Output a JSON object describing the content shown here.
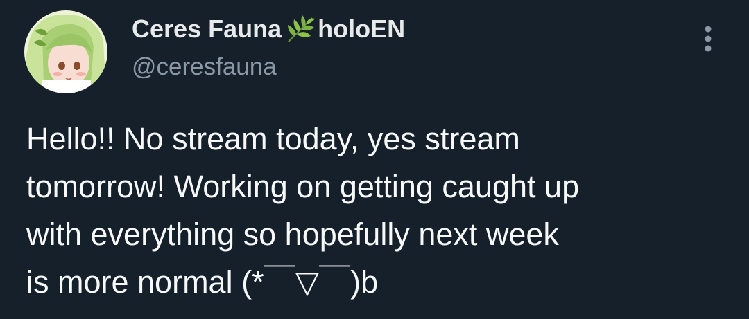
{
  "tweet": {
    "author": {
      "display_name": "Ceres Fauna",
      "name_emoji": "leaf-icon",
      "name_suffix": "holoEN",
      "handle": "@ceresfauna",
      "avatar": "avatar-image"
    },
    "menu_icon": "more-vertical-icon",
    "body_lines": [
      "Hello!! No stream today, yes stream",
      "tomorrow! Working on getting caught up",
      "with everything so hopefully next week",
      "is more normal (*￣▽￣)b"
    ]
  },
  "colors": {
    "background": "#15202b",
    "text_primary": "#f7f9f9",
    "text_secondary": "#8b98a5",
    "leaf": "#7cb342"
  }
}
